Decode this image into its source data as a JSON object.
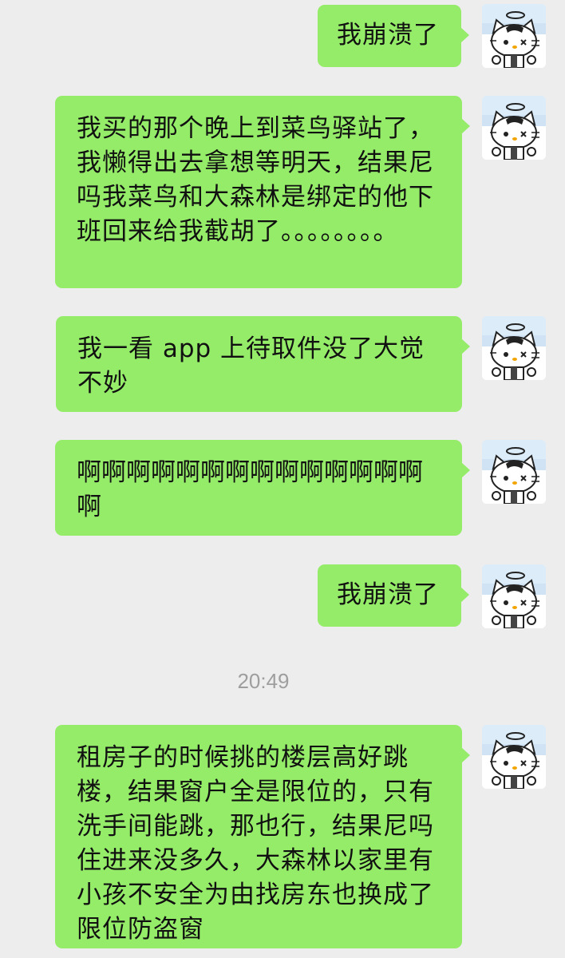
{
  "colors": {
    "background": "#ededed",
    "outgoing_bubble": "#95ec69",
    "timestamp_text": "#9e9e9e"
  },
  "messages": [
    {
      "sender": "me",
      "text": "我崩溃了"
    },
    {
      "sender": "me",
      "text": "我买的那个晚上到菜鸟驿站了，我懒得出去拿想等明天，结果尼吗我菜鸟和大森林是绑定的他下班回来给我截胡了。。。。。。。。"
    },
    {
      "sender": "me",
      "text": "我一看 app 上待取件没了大觉不妙"
    },
    {
      "sender": "me",
      "text": "啊啊啊啊啊啊啊啊啊啊啊啊啊啊啊"
    },
    {
      "sender": "me",
      "text": "我崩溃了"
    },
    {
      "sender": "me",
      "text": "租房子的时候挑的楼层高好跳楼，结果窗户全是限位的，只有洗手间能跳，那也行，结果尼吗住进来没多久，大森林以家里有小孩不安全为由找房东也换成了限位防盗窗"
    }
  ],
  "timestamp": "20:49",
  "avatar_icon": "cat-avatar-icon"
}
